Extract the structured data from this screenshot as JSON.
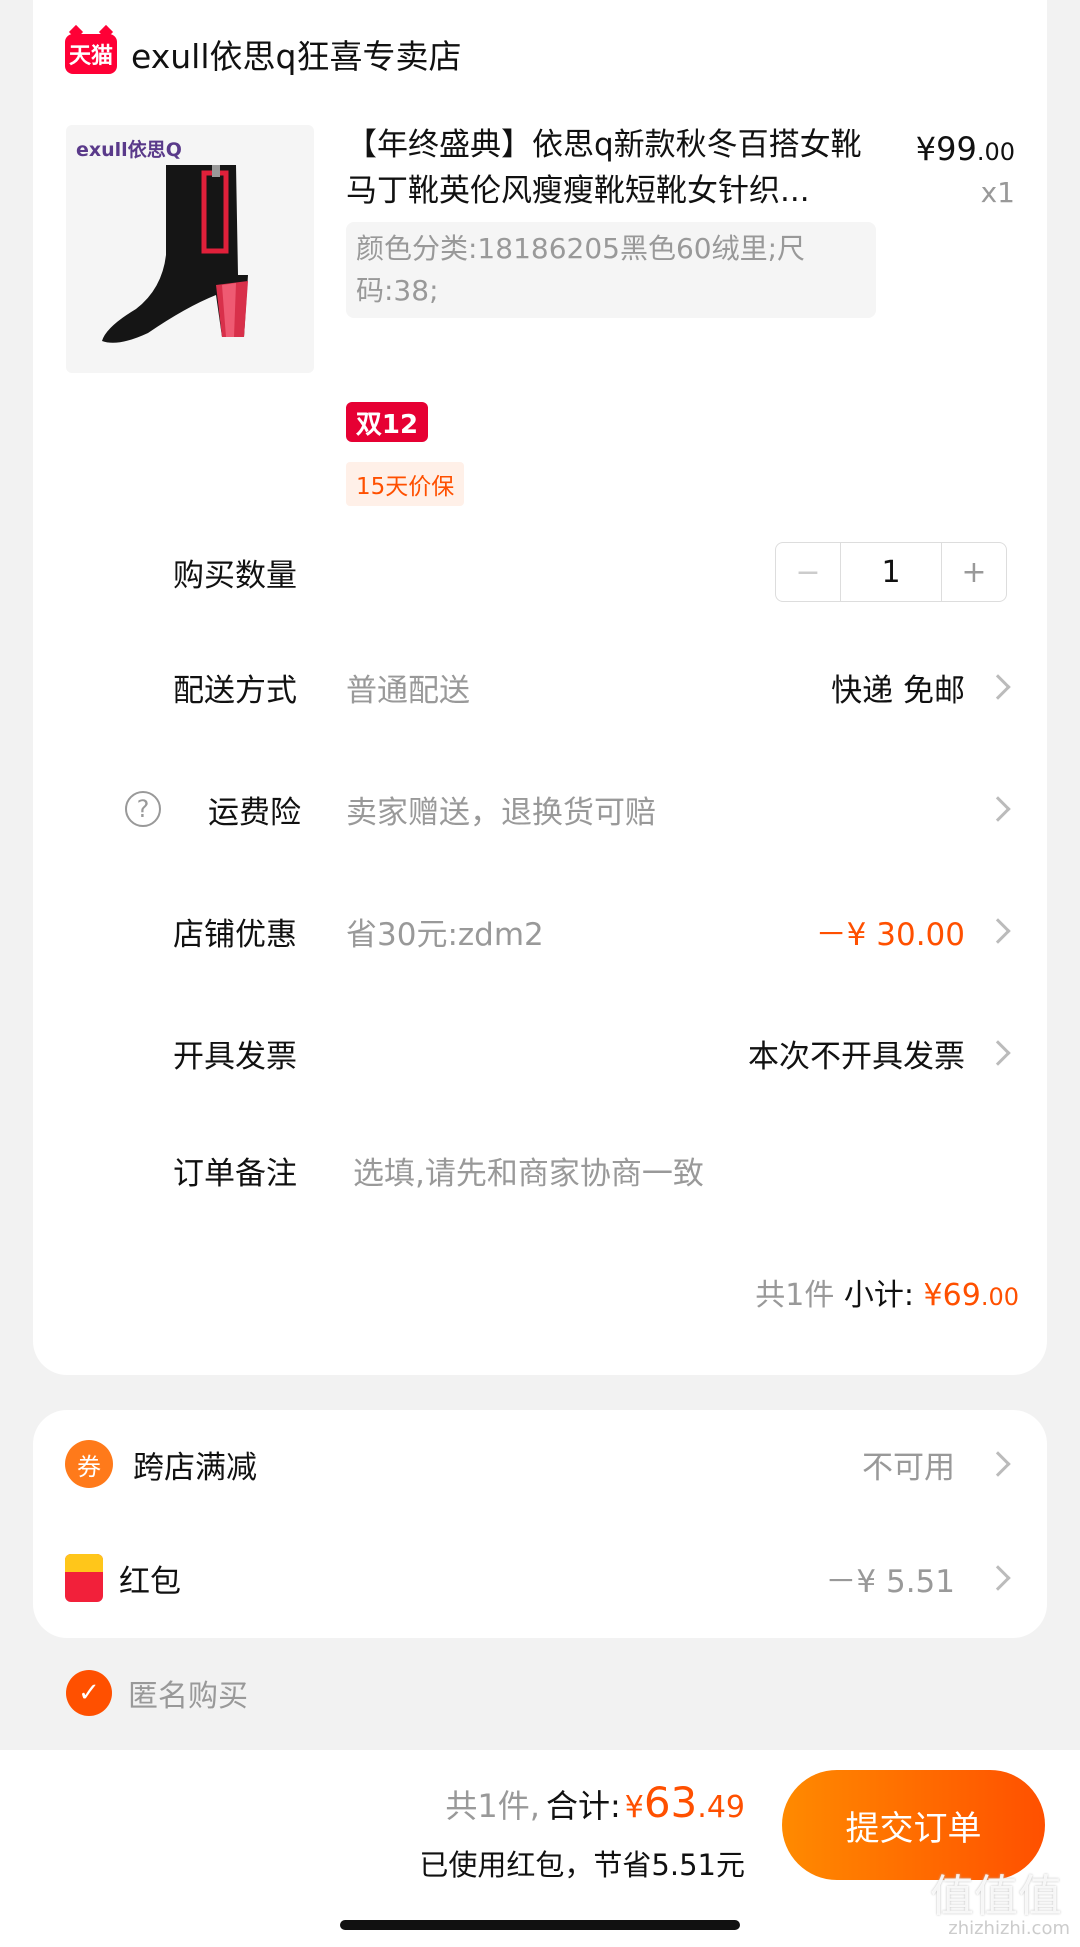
{
  "store": {
    "logo_text": "天猫",
    "name": "exull依思q狂喜专卖店"
  },
  "product": {
    "image_brand": "exull依思Q",
    "title": "【年终盛典】依思q新款秋冬百搭女靴马丁靴英伦风瘦瘦靴短靴女针织...",
    "price_symbol": "¥",
    "price_int": "99",
    "price_dec": ".00",
    "quantity_label": "x1",
    "sku": "颜色分类:18186205黑色60绒里;尺码:38;",
    "tag_promo": "双12",
    "tag_protect": "15天价保"
  },
  "quantity": {
    "label": "购买数量",
    "minus": "−",
    "value": "1",
    "plus": "+"
  },
  "delivery": {
    "label": "配送方式",
    "value": "普通配送",
    "right": "快递 免邮"
  },
  "insurance": {
    "icon": "?",
    "label": "运费险",
    "value": "卖家赠送，退换货可赔"
  },
  "store_discount": {
    "label": "店铺优惠",
    "value": "省30元:zdm2",
    "right": "－¥ 30.00"
  },
  "invoice": {
    "label": "开具发票",
    "right": "本次不开具发票"
  },
  "note": {
    "label": "订单备注",
    "placeholder": "选填,请先和商家协商一致"
  },
  "subtotal": {
    "count": "共1件",
    "label": "小计:",
    "symbol": "¥",
    "int": "69",
    "dec": ".00"
  },
  "cross_store": {
    "icon": "券",
    "label": "跨店满减",
    "right": "不可用"
  },
  "red_packet": {
    "label": "红包",
    "right": "－¥ 5.51"
  },
  "anonymous": {
    "check": "✓",
    "label": "匿名购买"
  },
  "footer": {
    "count": "共1件,",
    "total_label": "合计:",
    "symbol": "¥",
    "total_int": "63",
    "total_dec": ".49",
    "saved": "已使用红包，节省5.51元",
    "submit": "提交订单",
    "watermark": "值值值",
    "watermark_sub": "zhizhizhi.com"
  },
  "colors": {
    "accent": "#ff5000",
    "tmall_red": "#ff0036",
    "background": "#f2f2f2"
  }
}
